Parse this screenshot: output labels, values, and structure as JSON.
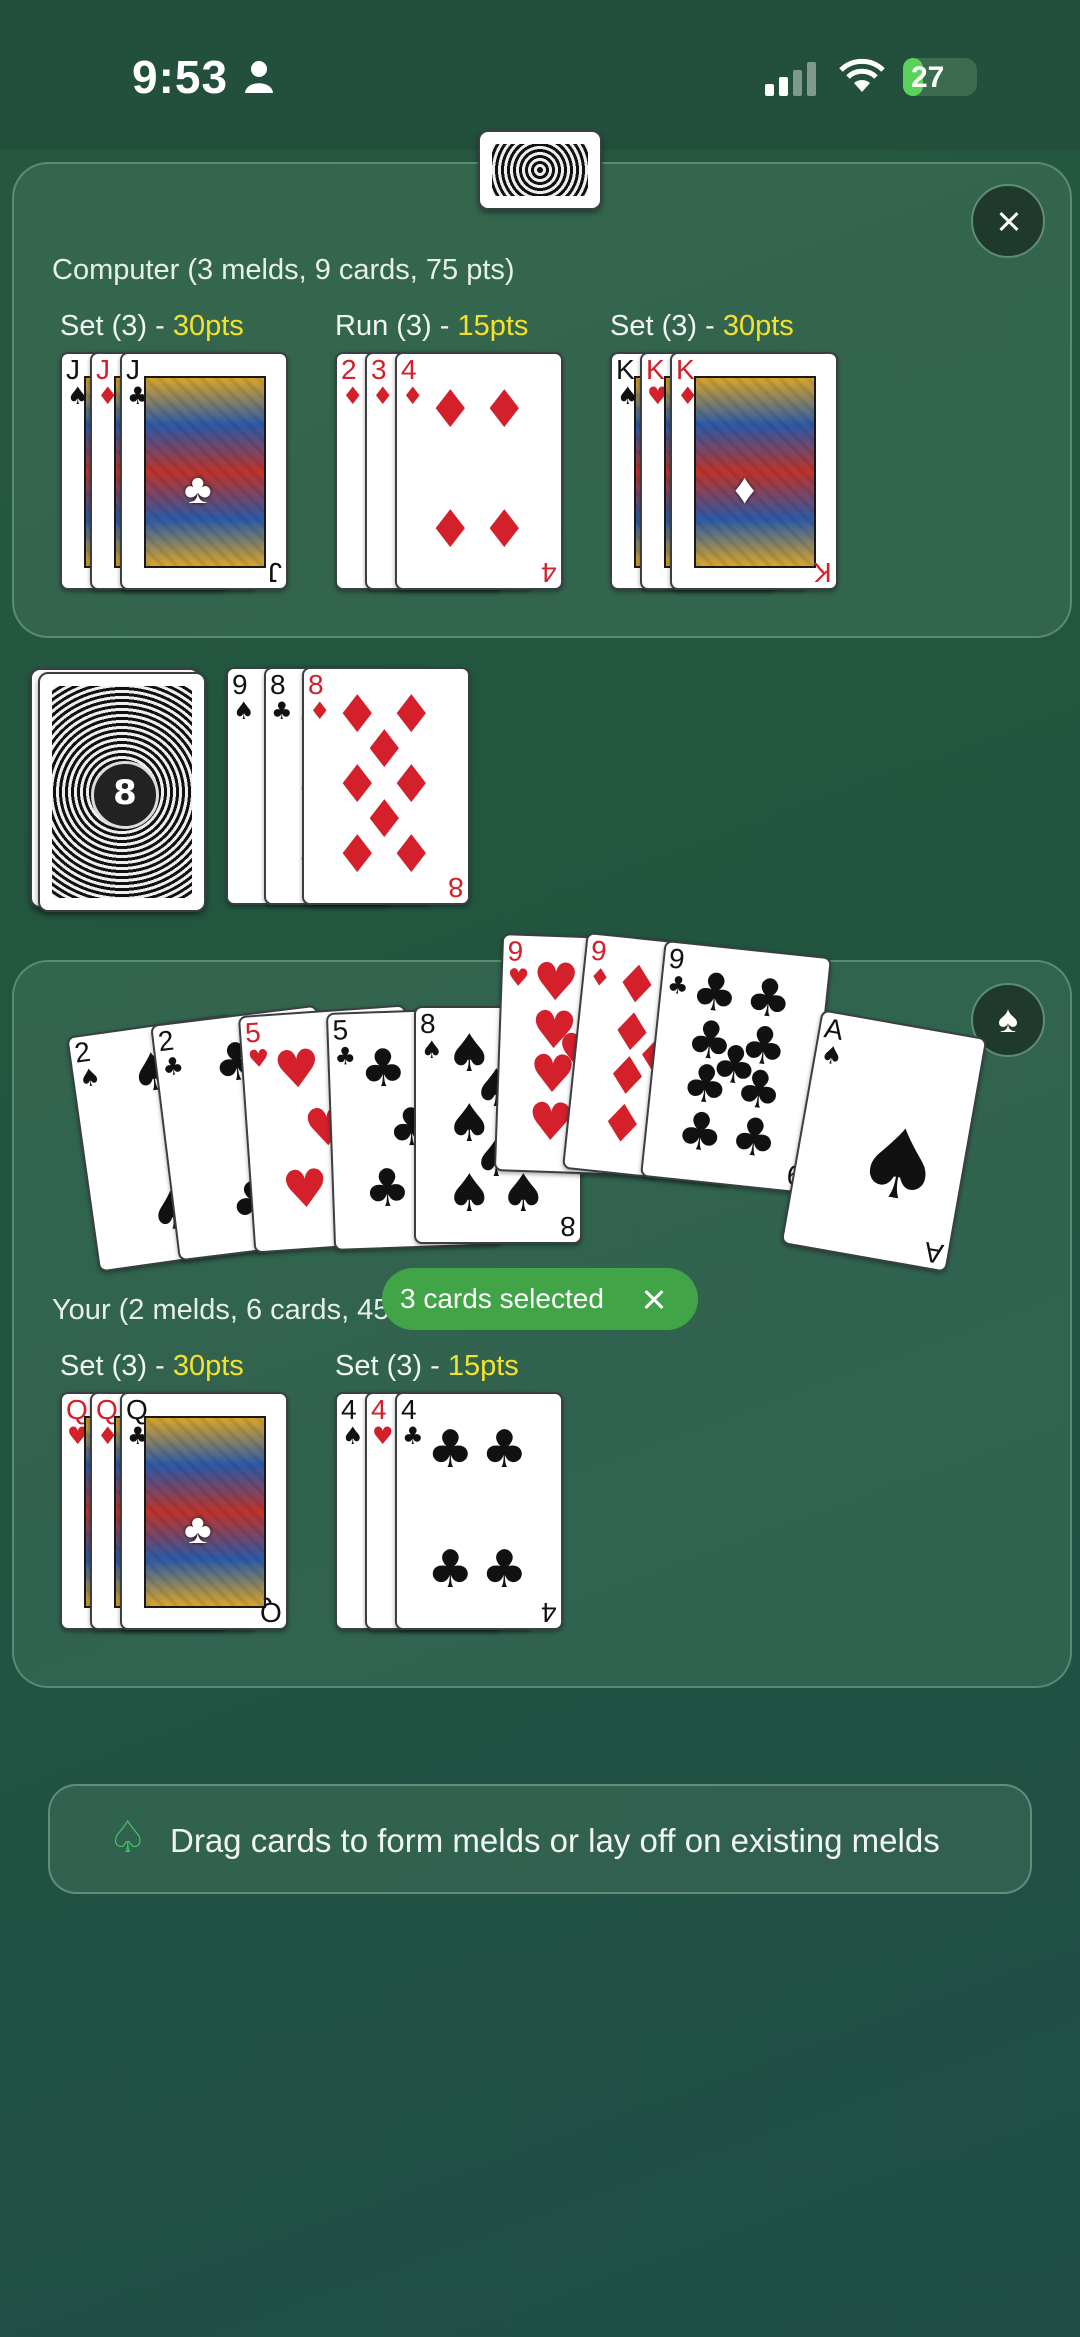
{
  "status_bar": {
    "time": "9:53",
    "battery": "27",
    "battery_level": 0.27
  },
  "computer": {
    "label": "Computer (3 melds, 9 cards, 75 pts)",
    "melds": [
      {
        "kind": "Set (3) - ",
        "pts": "30pts",
        "cards": [
          {
            "rank": "J",
            "suit": "♠"
          },
          {
            "rank": "J",
            "suit": "♦"
          },
          {
            "rank": "J",
            "suit": "♣"
          }
        ]
      },
      {
        "kind": "Run (3) - ",
        "pts": "15pts",
        "cards": [
          {
            "rank": "2",
            "suit": "♦"
          },
          {
            "rank": "3",
            "suit": "♦"
          },
          {
            "rank": "4",
            "suit": "♦"
          }
        ]
      },
      {
        "kind": "Set (3) - ",
        "pts": "30pts",
        "cards": [
          {
            "rank": "K",
            "suit": "♠"
          },
          {
            "rank": "K",
            "suit": "♥"
          },
          {
            "rank": "K",
            "suit": "♦"
          }
        ]
      }
    ]
  },
  "discard_pile": [
    {
      "rank": "9",
      "suit": "♠"
    },
    {
      "rank": "8",
      "suit": "♣"
    },
    {
      "rank": "8",
      "suit": "♦"
    }
  ],
  "hand": [
    {
      "rank": "2",
      "suit": "♠"
    },
    {
      "rank": "2",
      "suit": "♣"
    },
    {
      "rank": "5",
      "suit": "♥"
    },
    {
      "rank": "5",
      "suit": "♣"
    },
    {
      "rank": "8",
      "suit": "♠"
    },
    {
      "rank": "9",
      "suit": "♥"
    },
    {
      "rank": "9",
      "suit": "♦"
    },
    {
      "rank": "9",
      "suit": "♣"
    },
    {
      "rank": "A",
      "suit": "♠"
    }
  ],
  "player": {
    "label": "Your (2 melds, 6 cards, 45",
    "melds": [
      {
        "kind": "Set (3) - ",
        "pts": "30pts",
        "cards": [
          {
            "rank": "Q",
            "suit": "♥"
          },
          {
            "rank": "Q",
            "suit": "♦"
          },
          {
            "rank": "Q",
            "suit": "♣"
          }
        ]
      },
      {
        "kind": "Set (3) - ",
        "pts": "15pts",
        "cards": [
          {
            "rank": "4",
            "suit": "♠"
          },
          {
            "rank": "4",
            "suit": "♥"
          },
          {
            "rank": "4",
            "suit": "♣"
          }
        ]
      }
    ]
  },
  "selection_chip": {
    "text": "3 cards selected"
  },
  "hint": {
    "text": "Drag cards to form melds or lay off on existing melds",
    "icon": "spade-outline-icon"
  },
  "deck_logo": "8",
  "suit_button": "♠",
  "colors": {
    "pts": "#f3e12c",
    "chip": "#41a548",
    "hint_icon": "#3fd06a",
    "red_suit": "#d3202a"
  }
}
